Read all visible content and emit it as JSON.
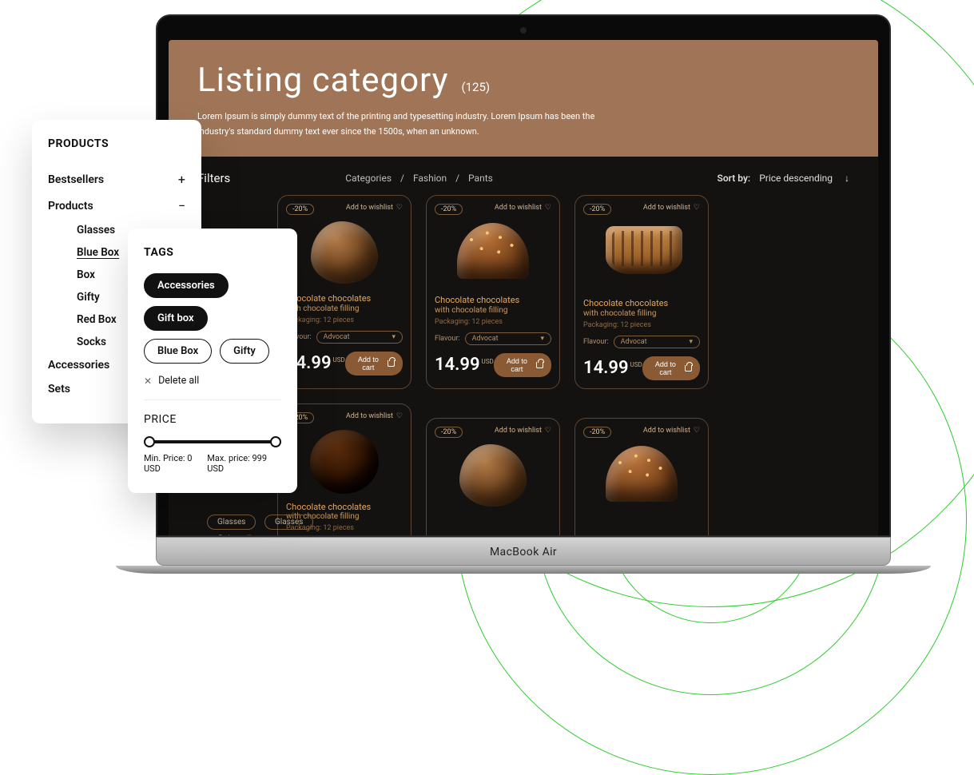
{
  "page": {
    "title": "Listing category",
    "count": "(125)",
    "desc": "Lorem Ipsum is simply dummy text of the printing and typesetting industry. Lorem Ipsum has been the industry's standard dummy text ever since the 1500s, when an unknown."
  },
  "toolbar": {
    "filters_label": "Filters",
    "breadcrumb": {
      "a": "Categories",
      "b": "Fashion",
      "c": "Pants",
      "sep": "/"
    },
    "sort_label": "Sort by:",
    "sort_value": "Price descending",
    "sort_arrow": "↓"
  },
  "chips_screen": {
    "a": "Glasses",
    "b": "Glasses",
    "delete": "Delete all",
    "x": "✕"
  },
  "card": {
    "badge": "-20%",
    "wishlist": "Add to wishlist",
    "title": "Chocolate chocolates",
    "subtitle": "with chocolate filling",
    "packaging": "Packaging: 12 pieces",
    "flavour_label": "Flavour:",
    "flavour_value": "Advocat",
    "price": "14.99",
    "currency": "USD",
    "add_to_cart": "Add to cart",
    "chevron": "▾",
    "heart": "♡"
  },
  "products_panel": {
    "heading": "PRODUCTS",
    "cats": {
      "bestsellers": "Bestsellers",
      "products": "Products",
      "accessories": "Accessories",
      "sets": "Sets",
      "plus": "+",
      "minus": "−"
    },
    "sub": {
      "glasses": "Glasses",
      "blue": "Blue Box",
      "box": "Box",
      "gifty": "Gifty",
      "red": "Red Box",
      "socks": "Socks"
    }
  },
  "tags_panel": {
    "heading": "TAGS",
    "tags": {
      "acc": "Accessories",
      "gift": "Gift box",
      "blue": "Blue Box",
      "gifty": "Gifty"
    },
    "delete": "Delete all",
    "x": "✕",
    "price_heading": "PRICE",
    "min_label": "Min. Price: 0 USD",
    "max_label": "Max. price: 999 USD"
  },
  "device": {
    "name": "MacBook Air"
  }
}
